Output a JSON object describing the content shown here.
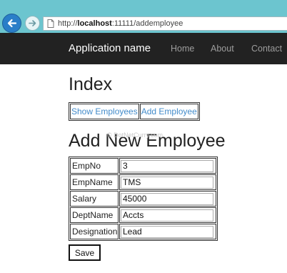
{
  "browser": {
    "url_prefix": "http://",
    "url_host": "localhost",
    "url_rest": ":11111/addemployee",
    "back_icon": "back-arrow-icon",
    "forward_icon": "forward-arrow-icon",
    "page_icon": "page-icon",
    "chrome_color": "#6cc5cf",
    "back_button_color": "#2a7ec8"
  },
  "navbar": {
    "brand": "Application name",
    "links": [
      "Home",
      "About",
      "Contact"
    ],
    "background": "#222222"
  },
  "main": {
    "index_heading": "Index",
    "actions": {
      "show_employees": "Show Employees",
      "add_employee": "Add Employee",
      "link_color": "#428bca"
    },
    "form_heading": "Add New Employee",
    "watermark": "© DotNetCurry.com",
    "fields": [
      {
        "label": "EmpNo",
        "value": "3"
      },
      {
        "label": "EmpName",
        "value": "TMS"
      },
      {
        "label": "Salary",
        "value": "45000"
      },
      {
        "label": "DeptName",
        "value": "Accts"
      },
      {
        "label": "Designation",
        "value": "Lead"
      }
    ],
    "save_label": "Save"
  }
}
